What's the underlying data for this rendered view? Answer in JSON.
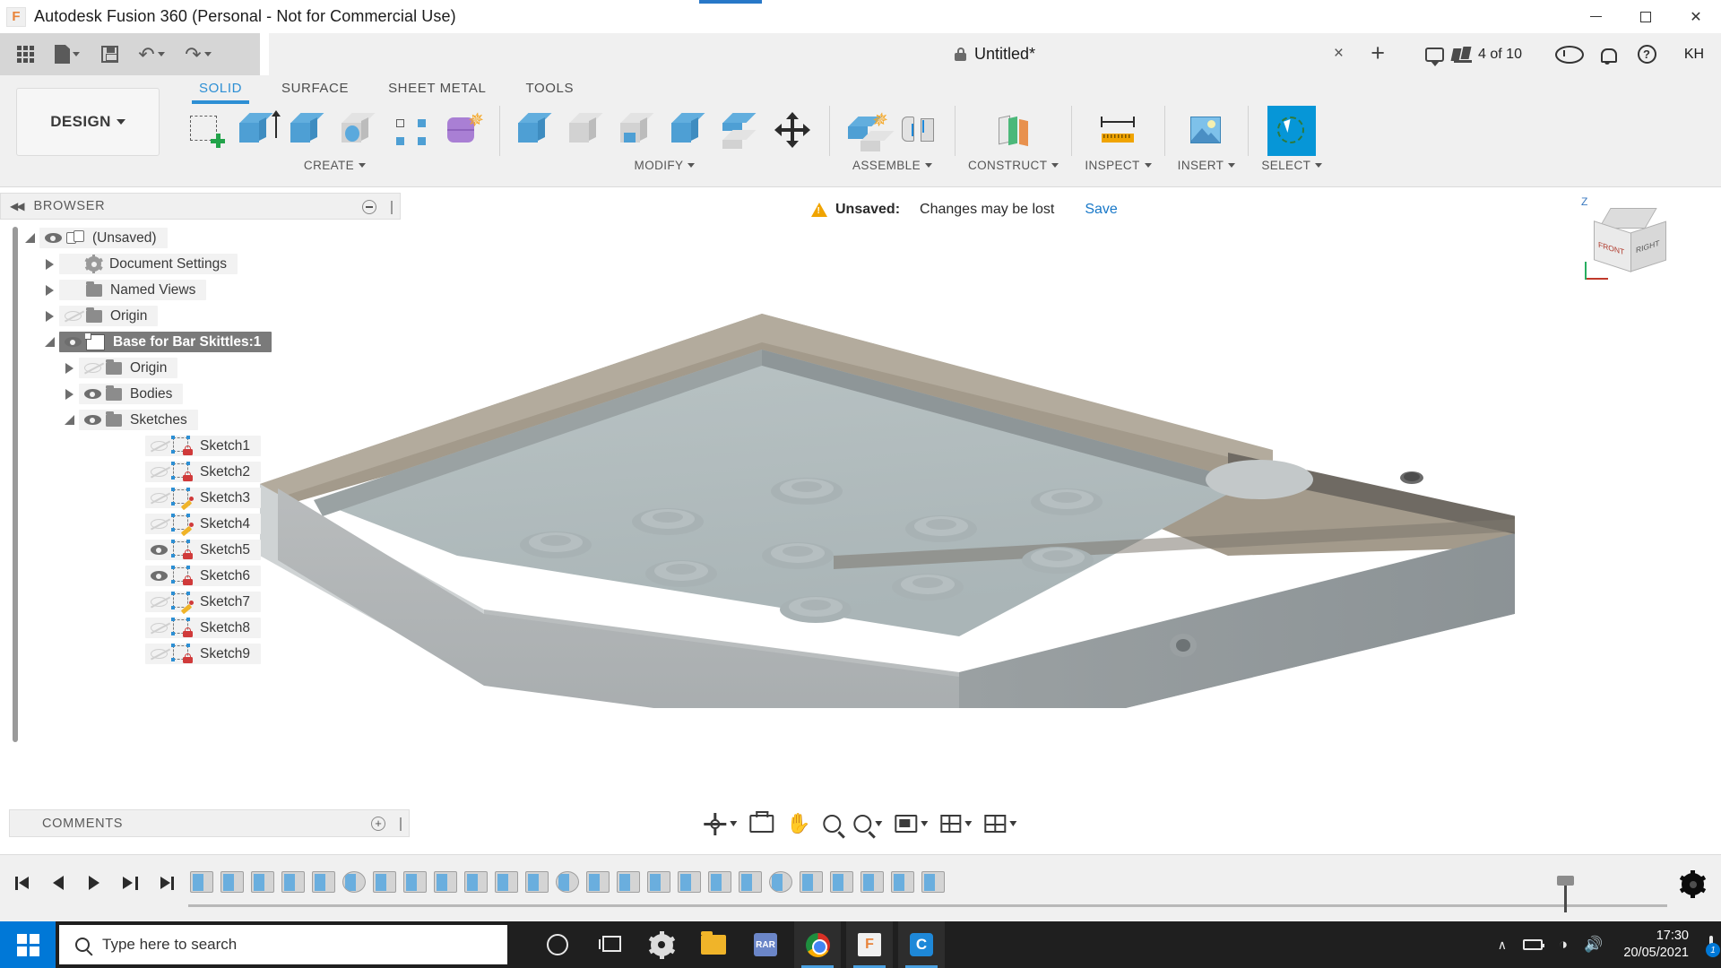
{
  "window": {
    "title": "Autodesk Fusion 360 (Personal - Not for Commercial Use)",
    "app_icon": "F",
    "minimize": "minimize",
    "maximize": "maximize",
    "close": "✕"
  },
  "quick_access": {
    "items": [
      {
        "name": "app-grid",
        "label": "Show Data Panel"
      },
      {
        "name": "file-menu",
        "label": "File"
      },
      {
        "name": "save",
        "label": "Save"
      },
      {
        "name": "undo",
        "label": "Undo"
      },
      {
        "name": "redo",
        "label": "Redo"
      }
    ]
  },
  "document_tab": {
    "title": "Untitled*",
    "lock_icon": "lock-icon",
    "close": "×",
    "new_tab": "+",
    "jobs_status": "4 of 10",
    "icons": [
      "comment-icon",
      "jobs-icon",
      "clock-icon",
      "bell-icon",
      "help-icon"
    ],
    "account_initials": "KH"
  },
  "ribbon": {
    "workspace": "DESIGN",
    "tabs": [
      {
        "label": "SOLID",
        "active": true
      },
      {
        "label": "SURFACE",
        "active": false
      },
      {
        "label": "SHEET METAL",
        "active": false
      },
      {
        "label": "TOOLS",
        "active": false
      }
    ],
    "panels": [
      {
        "label": "CREATE",
        "tools": [
          {
            "name": "create-sketch",
            "icon": "sketch-plus-icon"
          },
          {
            "name": "extrude",
            "icon": "extrude-icon"
          },
          {
            "name": "revolve",
            "icon": "revolve-icon"
          },
          {
            "name": "hole",
            "icon": "hole-icon"
          },
          {
            "name": "pattern",
            "icon": "pattern-icon"
          },
          {
            "name": "form",
            "icon": "form-icon"
          }
        ]
      },
      {
        "label": "MODIFY",
        "tools": [
          {
            "name": "press-pull",
            "icon": "press-pull-icon"
          },
          {
            "name": "fillet",
            "icon": "fillet-icon"
          },
          {
            "name": "shell",
            "icon": "shell-icon"
          },
          {
            "name": "combine",
            "icon": "combine-icon"
          },
          {
            "name": "split-face",
            "icon": "split-face-icon"
          },
          {
            "name": "move-copy",
            "icon": "move-arrows-icon"
          }
        ]
      },
      {
        "label": "ASSEMBLE",
        "tools": [
          {
            "name": "new-component",
            "icon": "new-component-icon"
          },
          {
            "name": "joint",
            "icon": "joint-icon"
          }
        ]
      },
      {
        "label": "CONSTRUCT",
        "tools": [
          {
            "name": "offset-plane",
            "icon": "offset-plane-icon"
          }
        ]
      },
      {
        "label": "INSPECT",
        "tools": [
          {
            "name": "measure",
            "icon": "measure-ruler-icon"
          }
        ]
      },
      {
        "label": "INSERT",
        "tools": [
          {
            "name": "insert-canvas",
            "icon": "photo-icon"
          }
        ]
      },
      {
        "label": "SELECT",
        "tools": [
          {
            "name": "select-tool",
            "icon": "select-cursor-icon",
            "selected": true
          }
        ]
      }
    ]
  },
  "browser": {
    "title": "BROWSER",
    "collapse_icon": "collapse-left-icon",
    "minimize_icon": "minus-circle-icon",
    "tree": [
      {
        "label": "(Unsaved)",
        "indent": 1,
        "twisty": "open",
        "eye": "on",
        "icon": "component-icon",
        "selected": false
      },
      {
        "label": "Document Settings",
        "indent": 2,
        "twisty": "closed",
        "eye": "none",
        "icon": "gear-icon",
        "selected": false
      },
      {
        "label": "Named Views",
        "indent": 2,
        "twisty": "closed",
        "eye": "none",
        "icon": "folder-icon",
        "selected": false
      },
      {
        "label": "Origin",
        "indent": 2,
        "twisty": "closed",
        "eye": "off",
        "icon": "folder-icon",
        "selected": false
      },
      {
        "label": "Base for Bar Skittles:1",
        "indent": 2,
        "twisty": "open",
        "eye": "on",
        "icon": "body-icon",
        "selected": true,
        "marker": true
      },
      {
        "label": "Origin",
        "indent": 3,
        "twisty": "closed",
        "eye": "off",
        "icon": "folder-icon",
        "selected": false
      },
      {
        "label": "Bodies",
        "indent": 3,
        "twisty": "closed",
        "eye": "on",
        "icon": "folder-icon",
        "selected": false
      },
      {
        "label": "Sketches",
        "indent": 3,
        "twisty": "open",
        "eye": "on",
        "icon": "folder-icon",
        "selected": false
      },
      {
        "label": "Sketch1",
        "indent": 4,
        "twisty": "none",
        "eye": "off",
        "icon": "sketch-locked-icon",
        "selected": false
      },
      {
        "label": "Sketch2",
        "indent": 4,
        "twisty": "none",
        "eye": "off",
        "icon": "sketch-locked-icon",
        "selected": false
      },
      {
        "label": "Sketch3",
        "indent": 4,
        "twisty": "none",
        "eye": "off",
        "icon": "sketch-editable-icon",
        "selected": false
      },
      {
        "label": "Sketch4",
        "indent": 4,
        "twisty": "none",
        "eye": "off",
        "icon": "sketch-editable-icon",
        "selected": false
      },
      {
        "label": "Sketch5",
        "indent": 4,
        "twisty": "none",
        "eye": "on",
        "icon": "sketch-locked-icon",
        "selected": false
      },
      {
        "label": "Sketch6",
        "indent": 4,
        "twisty": "none",
        "eye": "on",
        "icon": "sketch-locked-icon",
        "selected": false
      },
      {
        "label": "Sketch7",
        "indent": 4,
        "twisty": "none",
        "eye": "off",
        "icon": "sketch-editable-icon",
        "selected": false
      },
      {
        "label": "Sketch8",
        "indent": 4,
        "twisty": "none",
        "eye": "off",
        "icon": "sketch-locked-icon",
        "selected": false
      },
      {
        "label": "Sketch9",
        "indent": 4,
        "twisty": "none",
        "eye": "off",
        "icon": "sketch-locked-icon",
        "selected": false
      }
    ]
  },
  "comments": {
    "title": "COMMENTS",
    "add_icon": "plus-circle-icon"
  },
  "notification": {
    "icon": "warning-icon",
    "status": "Unsaved:",
    "message": "Changes may be lost",
    "action": "Save",
    "action_color": "#1878c8"
  },
  "viewcube": {
    "z_label": "Z",
    "front_label": "FRONT",
    "right_label": "RIGHT"
  },
  "navbar": {
    "items": [
      {
        "name": "orbit",
        "icon": "orbit-icon",
        "caret": true
      },
      {
        "name": "look-at",
        "icon": "camera-icon",
        "caret": false
      },
      {
        "name": "pan",
        "icon": "hand-icon",
        "caret": false
      },
      {
        "name": "zoom",
        "icon": "zoom-in-icon",
        "caret": false
      },
      {
        "name": "fit",
        "icon": "magnifier-icon",
        "caret": true
      },
      {
        "name": "display-settings",
        "icon": "display-icon",
        "caret": true
      },
      {
        "name": "grid-snaps",
        "icon": "grid-icon",
        "caret": true
      },
      {
        "name": "viewports",
        "icon": "layout-icon",
        "caret": true
      }
    ]
  },
  "timeline": {
    "playback": [
      {
        "name": "go-to-beginning",
        "icon": "skip-start-icon"
      },
      {
        "name": "step-back",
        "icon": "play-back-icon"
      },
      {
        "name": "play",
        "icon": "play-icon"
      },
      {
        "name": "step-forward",
        "icon": "step-forward-icon"
      },
      {
        "name": "go-to-end",
        "icon": "skip-end-icon"
      }
    ],
    "feature_count": 25,
    "settings_icon": "gear-icon"
  },
  "taskbar": {
    "start": "start-button",
    "search_placeholder": "Type here to search",
    "search_icon": "search-icon",
    "apps": [
      {
        "name": "cortana",
        "icon": "cortana-icon",
        "active": false
      },
      {
        "name": "task-view",
        "icon": "task-view-icon",
        "active": false
      },
      {
        "name": "settings",
        "icon": "gear-icon",
        "active": false
      },
      {
        "name": "file-explorer",
        "icon": "folder-icon",
        "active": false
      },
      {
        "name": "winrar",
        "icon": "rar-icon",
        "active": false
      },
      {
        "name": "chrome",
        "icon": "chrome-icon",
        "active": true
      },
      {
        "name": "fusion360",
        "icon": "fusion-icon",
        "active": true
      },
      {
        "name": "cortana-app",
        "icon": "c-icon",
        "active": true
      }
    ],
    "tray": {
      "chevron": "∧",
      "time": "17:30",
      "date": "20/05/2021",
      "notification_count": "1"
    }
  }
}
